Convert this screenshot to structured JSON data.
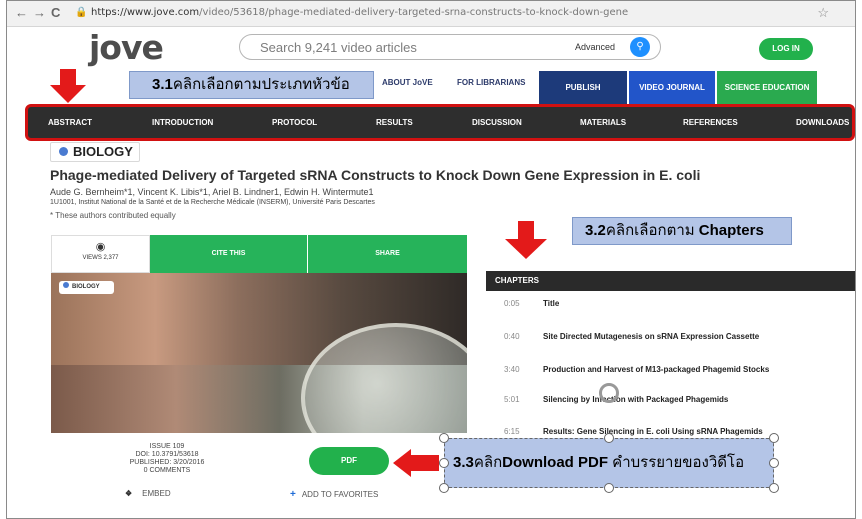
{
  "browser": {
    "back": "←",
    "forward": "→",
    "reload": "C",
    "url_host": "https://www.jove.com",
    "url_path": "/video/53618/phage-mediated-delivery-targeted-srna-constructs-to-knock-down-gene",
    "star": "☆"
  },
  "header": {
    "logo": "jove",
    "search_placeholder": "Search 9,241 video articles",
    "advanced": "Advanced",
    "search_icon": "search-icon",
    "login": "LOG IN"
  },
  "topnav": {
    "about": "ABOUT JoVE",
    "librarians": "FOR LIBRARIANS",
    "publish": "PUBLISH",
    "video_journal": "VIDEO JOURNAL",
    "science_education": "SCIENCE EDUCATION"
  },
  "annotations": {
    "a31_num": "3.1",
    "a31_text": "คลิกเลือกตามประเภทหัวข้อ",
    "a32_num": "3.2",
    "a32_text": "คลิกเลือกตาม ",
    "a32_bold": "Chapters",
    "a33_num": "3.3",
    "a33_text": "คลิก",
    "a33_bold": "Download PDF",
    "a33_tail": " คำบรรยายของวิดีโอ"
  },
  "sections": [
    "ABSTRACT",
    "INTRODUCTION",
    "PROTOCOL",
    "RESULTS",
    "DISCUSSION",
    "MATERIALS",
    "REFERENCES",
    "DOWNLOADS"
  ],
  "article": {
    "category": "BIOLOGY",
    "title": "Phage-mediated Delivery of Targeted sRNA Constructs to Knock Down Gene Expression in E. coli",
    "authors": "Aude G. Bernheim*1, Vincent K. Libis*1, Ariel B. Lindner1, Edwin H. Wintermute1",
    "affiliation": "1U1001, Institut National de la Santé et de la Recherche Médicale (INSERM), Université Paris Descartes",
    "contrib": "* These authors contributed equally"
  },
  "tabs": {
    "views": "VIEWS 2,377",
    "cite": "CITE THIS",
    "share": "SHARE"
  },
  "video": {
    "badge": "BIOLOGY"
  },
  "chapters": {
    "heading": "CHAPTERS",
    "items": [
      {
        "time": "0:05",
        "title": "Title"
      },
      {
        "time": "0:40",
        "title": "Site Directed Mutagenesis on sRNA Expression Cassette"
      },
      {
        "time": "3:40",
        "title": "Production and Harvest of M13-packaged Phagemid Stocks"
      },
      {
        "time": "5:01",
        "title": "Silencing by Infection with Packaged Phagemids"
      },
      {
        "time": "6:15",
        "title": "Results: Gene Silencing in E. coli Using sRNA Phagemids"
      }
    ]
  },
  "bottom": {
    "issue": "ISSUE 109",
    "doi": "DOI: 10.3791/53618",
    "published": "PUBLISHED: 3/20/2016",
    "comments": "0 COMMENTS",
    "pdf": "PDF",
    "embed": "EMBED",
    "favorites": "ADD TO FAVORITES"
  },
  "colors": {
    "accent_green": "#22b14c",
    "nav_dark_blue": "#1d3a7a",
    "nav_blue": "#2255c9",
    "annotation_red": "#e31a1a",
    "annotation_fill": "#b4c5e7"
  }
}
